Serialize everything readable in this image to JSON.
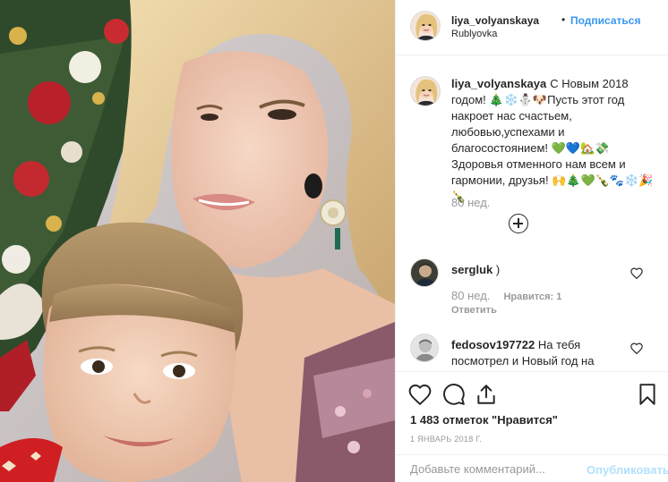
{
  "post": {
    "author": {
      "username": "liya_volyanskaya",
      "separator": "•",
      "follow_label": "Подписаться",
      "location": "Rublyovka",
      "avatar_icon": "user-avatar"
    },
    "caption": {
      "username": "liya_volyanskaya",
      "text": "С Новым 2018 годом! 🎄❄️⛄🐶Пусть этот год накроет нас счастьем, любовью,успехами и благосостоянием! 💚💙🏡💸Здоровья отменного нам всем и гармонии, друзья! 🙌🎄💚🍾🐾❄️🎉🍾",
      "time": "80 нед."
    },
    "load_more_icon": "plus-circle-icon",
    "comments": [
      {
        "username": "sergluk",
        "text": ")",
        "time": "80 нед.",
        "likes": "Нравится: 1",
        "reply": "Ответить"
      },
      {
        "username": "fedosov197722",
        "text": "На тебя посмотрел и Новый год на",
        "time": "",
        "likes": "",
        "reply": ""
      }
    ],
    "actions": {
      "icons": [
        "heart-icon",
        "comment-icon",
        "share-icon",
        "bookmark-icon"
      ]
    },
    "likes_count": "1 483 отметок \"Нравится\"",
    "date": "1 ЯНВАРЬ 2018 Г.",
    "add_comment": {
      "placeholder": "Добавьте комментарий...",
      "publish_label": "Опубликовать"
    }
  },
  "colors": {
    "accent": "#3897f0",
    "publish_disabled": "#b2dffc",
    "muted": "#999999",
    "text": "#262626",
    "border": "#efefef"
  }
}
